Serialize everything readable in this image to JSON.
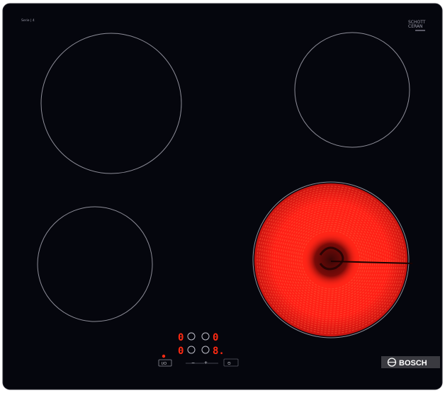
{
  "glass": {
    "top_left_text": "Serie | 4",
    "logo_line1": "SCHOTT",
    "logo_line2": "CERAN"
  },
  "controls": {
    "display_top_left": "0",
    "display_top_right": "0",
    "display_bottom_left": "0",
    "display_bottom_right": "8.",
    "key_power_label": "I/O",
    "key_minus_label": "−",
    "key_plus_label": "+",
    "key_timer_label": "⏲"
  },
  "brand": {
    "name": "BOSCH"
  },
  "colors": {
    "glass": "#05060d",
    "zone_outline": "#8d8d98",
    "heating_red": "#ff1e14",
    "display_red": "#ff2a12",
    "brand_plate": "#3a3a40"
  },
  "zones": {
    "rear_left": "off",
    "rear_right": "off",
    "front_left": "off",
    "front_right": "heating"
  }
}
